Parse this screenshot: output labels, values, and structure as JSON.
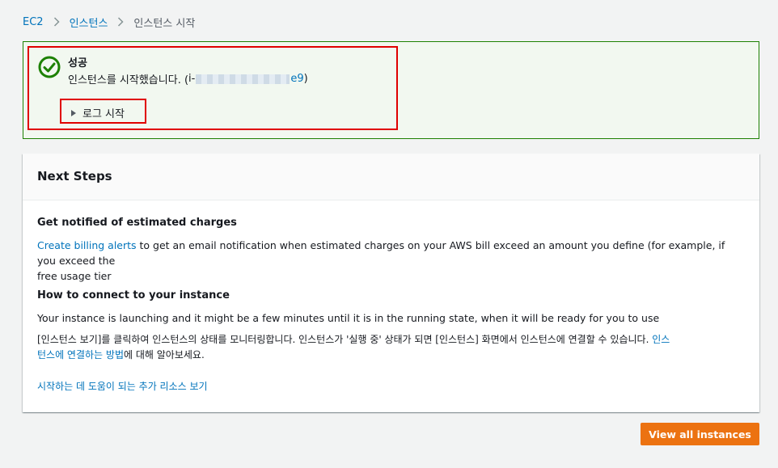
{
  "breadcrumb": {
    "items": [
      "EC2",
      "인스턴스"
    ],
    "current": "인스턴스 시작"
  },
  "flash": {
    "title": "성공",
    "message_prefix": "인스턴스를 시작했습니다. (",
    "instance_id_prefix": "i-",
    "instance_id_suffix": "e9",
    "message_suffix": ")",
    "log_toggle_label": "로그 시작",
    "status_color": "#1d8102"
  },
  "next_steps": {
    "title": "Next Steps",
    "charges": {
      "heading": "Get notified of estimated charges",
      "link": "Create billing alerts",
      "text_line1": " to get an email notification when estimated charges on your AWS bill exceed an amount you define (for example, if you exceed the",
      "text_line2": "free usage tier"
    },
    "connect": {
      "heading": "How to connect to your instance",
      "text": "Your instance is launching and it might be a few minutes until it is in the running state, when it will be ready for you to use",
      "korean_line1": "[인스턴스 보기]를 클릭하여 인스턴스의 상태를 모니터링합니다. 인스턴스가 '실행 중' 상태가 되면 [인스턴스] 화면에서 인스턴스에 연결할 수 있습니다. ",
      "korean_link_a": "인스",
      "korean_link_b": "턴스에 연결하는 방법",
      "korean_line2_suffix": "에 대해 알아보세요."
    },
    "resources_link": "시작하는 데 도움이 되는 추가 리소스 보기"
  },
  "footer": {
    "view_all_label": "View all instances",
    "accent_color": "#ec7211"
  },
  "icons": {
    "breadcrumb_separator": "chevron-right-icon",
    "success": "check-circle-icon",
    "log_toggle": "caret-right-icon"
  }
}
